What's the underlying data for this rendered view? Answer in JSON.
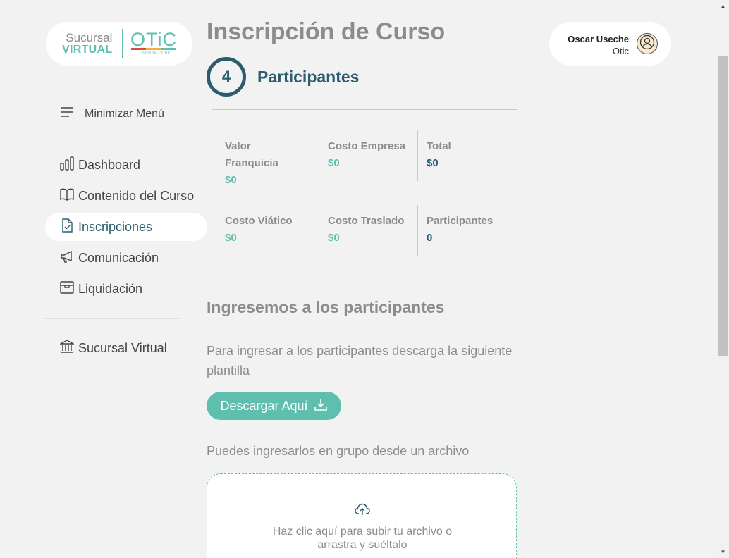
{
  "logo": {
    "line1": "Sucursal",
    "line2": "VIRTUAL",
    "brand": "OTiC",
    "sub": "somos CChC"
  },
  "sidebar": {
    "minimize_label": "Minimizar Menú",
    "items": [
      {
        "label": "Dashboard",
        "icon": "bar-chart-icon",
        "active": false
      },
      {
        "label": "Contenido del Curso",
        "icon": "book-icon",
        "active": false
      },
      {
        "label": "Inscripciones",
        "icon": "file-check-icon",
        "active": true
      },
      {
        "label": "Comunicación",
        "icon": "megaphone-icon",
        "active": false
      },
      {
        "label": "Liquidación",
        "icon": "archive-icon",
        "active": false
      }
    ],
    "extra": {
      "label": "Sucursal Virtual",
      "icon": "bank-icon"
    }
  },
  "main": {
    "title": "Inscripción de Curso",
    "step_number": "4",
    "step_label": "Participantes",
    "costs": [
      {
        "label": "Valor Franquicia",
        "value": "$0"
      },
      {
        "label": "Costo Empresa",
        "value": "$0"
      },
      {
        "label": "Total",
        "value": "$0"
      },
      {
        "label": "Costo Viático",
        "value": "$0"
      },
      {
        "label": "Costo Traslado",
        "value": "$0"
      },
      {
        "label": "Participantes",
        "value": "0"
      }
    ],
    "section_title": "Ingresemos a los participantes",
    "section_text": "Para ingresar a los participantes descarga la siguiente plantilla",
    "download_label": "Descargar Aquí",
    "group_text": "Puedes ingresarlos en grupo desde un archivo",
    "upload_text": "Haz clic aquí para subir tu archivo o arrastra y suéltalo"
  },
  "user": {
    "name": "Oscar Useche",
    "org": "Otic"
  },
  "colors": {
    "accent": "#5fbfae",
    "primary": "#2b5d6e",
    "muted": "#8c8c8c",
    "background": "#f2f2f2"
  }
}
